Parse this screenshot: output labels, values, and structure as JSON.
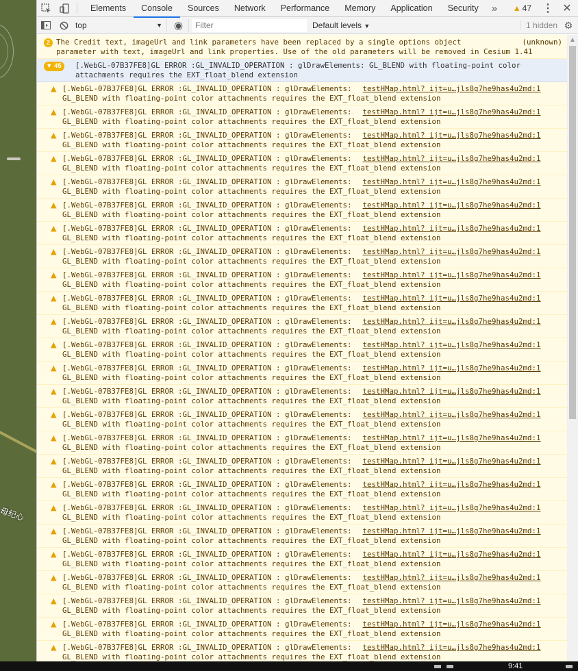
{
  "map": {
    "label": "母纪心"
  },
  "tabs": [
    "Elements",
    "Console",
    "Sources",
    "Network",
    "Performance",
    "Memory",
    "Application",
    "Security"
  ],
  "active_tab": "Console",
  "tabs_more": "»",
  "warnings_count": "47",
  "toolbar": {
    "context": "top",
    "filter_placeholder": "Filter",
    "levels": "Default levels",
    "hidden": "1 hidden"
  },
  "messages": {
    "credit_count": "2",
    "credit_line1": "The Credit text, imageUrl and link parameters have been replaced by a single options object",
    "credit_line2": "parameter with text, imageUrl and link properties. Use of the old parameters will be removed in Cesium 1.41",
    "credit_source": "(unknown)",
    "group_count": "45",
    "group_line1": "[.WebGL-07B37FE8]GL ERROR :GL_INVALID_OPERATION : glDrawElements: GL_BLEND with floating-point color",
    "group_line2": "attachments requires the EXT_float_blend extension",
    "error_line1": "[.WebGL-07B37FE8]GL ERROR :GL_INVALID_OPERATION : glDrawElements:",
    "error_line2": "GL_BLEND with floating-point color attachments requires the EXT_float_blend extension",
    "error_source": "testHMap.html? ijt=u…jls8g7he9has4u2md:1",
    "error_rows": 25
  },
  "taskbar": {
    "time": "9:41"
  },
  "colors": {
    "accent": "#1a73e8",
    "warning": "#f1b300",
    "warn_bg": "#fffbe5",
    "map": "#5b6b3a"
  }
}
